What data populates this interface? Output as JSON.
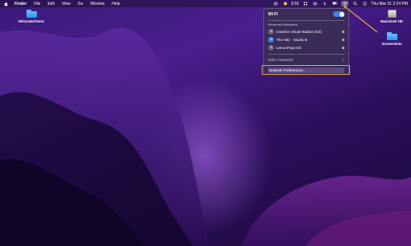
{
  "menubar": {
    "app_name": "Finder",
    "items": [
      "File",
      "Edit",
      "View",
      "Go",
      "Window",
      "Help"
    ],
    "battery_time": "6:55",
    "datetime": "Thu Mar 31  2:24 PM"
  },
  "desktop": {
    "icons": [
      {
        "label": "Relocated Items",
        "type": "folder"
      },
      {
        "label": "Macintosh HD",
        "type": "drive"
      },
      {
        "label": "Screenshots",
        "type": "folder"
      }
    ]
  },
  "wifi_menu": {
    "title": "Wi-Fi",
    "toggle_on": true,
    "preferred_header": "Preferred Networks",
    "networks": [
      {
        "name": "Instamix Visual Studios (5G)",
        "locked": true,
        "connected": false
      },
      {
        "name": "The Attic - Studio B",
        "locked": true,
        "connected": true
      },
      {
        "name": "LemonPops 5G",
        "locked": true,
        "connected": false
      }
    ],
    "other_networks": "Other Networks",
    "network_preferences": "Network Preferences..."
  },
  "colors": {
    "accent": "#3b82f6",
    "highlight": "#e8a83e",
    "folder": "#2c94e8"
  }
}
